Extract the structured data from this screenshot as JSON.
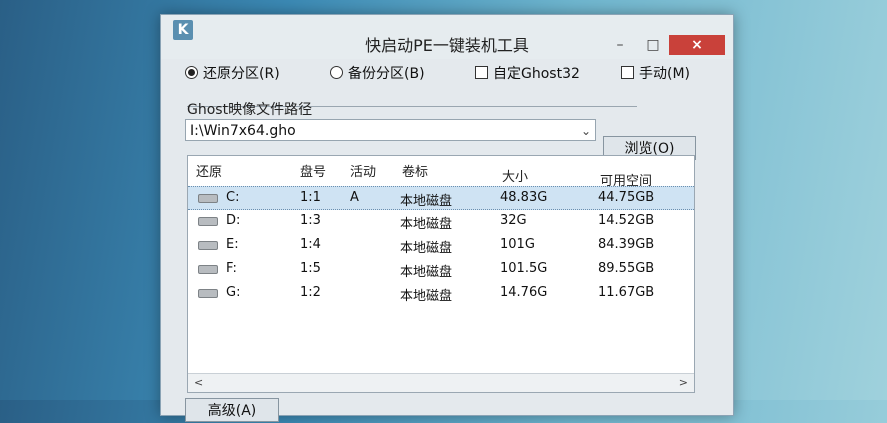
{
  "window": {
    "title": "快启动PE一键装机工具",
    "icon_letter": "K",
    "min": "–",
    "max": "□",
    "close": "×"
  },
  "options": [
    {
      "label": "还原分区(R)",
      "type": "radio",
      "checked": true
    },
    {
      "label": "备份分区(B)",
      "type": "radio",
      "checked": false
    },
    {
      "label": "自定Ghost32",
      "type": "checkbox",
      "checked": false
    },
    {
      "label": "手动(M)",
      "type": "checkbox",
      "checked": false
    }
  ],
  "image_path": {
    "label": "Ghost映像文件路径",
    "value": "I:\\Win7x64.gho",
    "dropdown": "⌄"
  },
  "browse_label": "浏览(O)",
  "table": {
    "headers": [
      "还原",
      "盘号",
      "活动",
      "卷标",
      "大小",
      "可用空间"
    ],
    "rows": [
      {
        "drive": "C:",
        "num": "1:1",
        "active": "A",
        "label": "本地磁盘",
        "size": "48.83G",
        "free": "44.75GB",
        "selected": true
      },
      {
        "drive": "D:",
        "num": "1:3",
        "active": "",
        "label": "本地磁盘",
        "size": "32G",
        "free": "14.52GB",
        "selected": false
      },
      {
        "drive": "E:",
        "num": "1:4",
        "active": "",
        "label": "本地磁盘",
        "size": "101G",
        "free": "84.39GB",
        "selected": false
      },
      {
        "drive": "F:",
        "num": "1:5",
        "active": "",
        "label": "本地磁盘",
        "size": "101.5G",
        "free": "89.55GB",
        "selected": false
      },
      {
        "drive": "G:",
        "num": "1:2",
        "active": "",
        "label": "本地磁盘",
        "size": "14.76G",
        "free": "11.67GB",
        "selected": false
      }
    ],
    "scroll_left": "<",
    "scroll_right": ">"
  },
  "advanced_label": "高级(A)"
}
